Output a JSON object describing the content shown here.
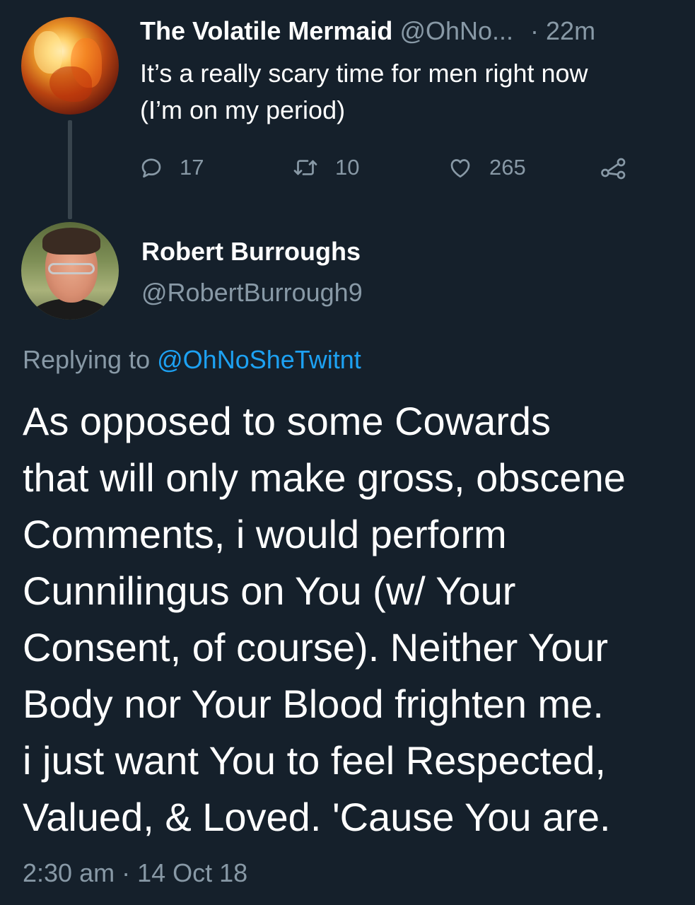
{
  "parent_tweet": {
    "display_name": "The Volatile Mermaid",
    "handle": "@OhNo...",
    "time": "· 22m",
    "text_lines": [
      "It’s a really scary time for men right now",
      "(I’m on my period)"
    ],
    "actions": {
      "reply": {
        "icon": "reply-icon",
        "count": "17"
      },
      "retweet": {
        "icon": "retweet-icon",
        "count": "10"
      },
      "like": {
        "icon": "heart-icon",
        "count": "265"
      },
      "share": {
        "icon": "share-icon"
      }
    }
  },
  "reply_tweet": {
    "display_name": "Robert Burroughs",
    "handle": "@RobertBurrough9",
    "replying_prefix": "Replying to",
    "replying_mention": "@OhNoSheTwitnt",
    "body_lines": [
      "As opposed to some Cowards",
      "that will only make gross, obscene",
      "Comments, i would perform",
      "Cunnilingus on You (w/ Your",
      "Consent, of course).  Neither Your",
      "Body nor Your Blood frighten me.",
      "i just want You to feel Respected,",
      "Valued, & Loved.  'Cause You are."
    ],
    "timestamp": "2:30 am · 14 Oct 18"
  },
  "colors": {
    "background": "#15202b",
    "text_primary": "#ffffff",
    "text_secondary": "#8899a6",
    "link": "#1da1f2",
    "thread_line": "#38444d"
  }
}
